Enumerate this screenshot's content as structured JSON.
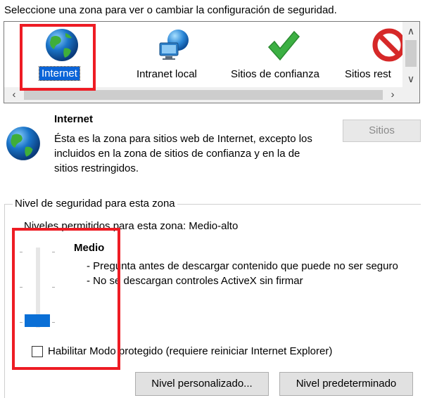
{
  "instruction": "Seleccione una zona para ver o cambiar la configuración de seguridad.",
  "zones": [
    {
      "label": "Internet",
      "icon": "globe-icon"
    },
    {
      "label": "Intranet local",
      "icon": "network-computer-icon"
    },
    {
      "label": "Sitios de confianza",
      "icon": "checkmark-icon"
    },
    {
      "label": "Sitios rest",
      "icon": "restricted-icon"
    }
  ],
  "selected_zone": {
    "title": "Internet",
    "description": "Ésta es la zona para sitios web de Internet, excepto los incluidos en la zona de sitios de confianza y en la de sitios restringidos.",
    "sites_button": "Sitios"
  },
  "security": {
    "group_title": "Nivel de seguridad para esta zona",
    "allowed_levels": "Niveles permitidos para esta zona: Medio-alto",
    "level_name": "Medio",
    "level_points": [
      "- Pregunta antes de descargar contenido que puede no ser seguro",
      "- No se descargan controles ActiveX sin firmar"
    ],
    "slider_level": 0,
    "slider_levels": 5,
    "protected_mode_label": "Habilitar Modo protegido (requiere reiniciar Internet Explorer)",
    "protected_mode_checked": false,
    "custom_button": "Nivel personalizado...",
    "default_button": "Nivel predeterminado"
  },
  "colors": {
    "highlight": "#ee1c24",
    "selection": "#0a64d8",
    "slider": "#0a6fd6"
  }
}
